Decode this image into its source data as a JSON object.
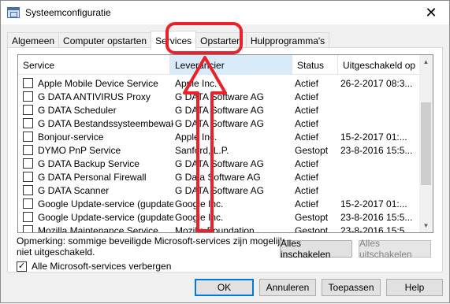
{
  "window": {
    "title": "Systeemconfiguratie"
  },
  "tabs": [
    {
      "label": "Algemeen"
    },
    {
      "label": "Computer opstarten"
    },
    {
      "label": "Services"
    },
    {
      "label": "Opstarten"
    },
    {
      "label": "Hulpprogramma's"
    }
  ],
  "columns": {
    "service": "Service",
    "manufacturer": "Leverancier",
    "status": "Status",
    "disabled_on": "Uitgeschakeld op"
  },
  "rows": [
    {
      "name": "Apple Mobile Device Service",
      "manufacturer": "Apple Inc.",
      "status": "Actief",
      "date": "26-2-2017 08:3..."
    },
    {
      "name": "G DATA ANTIVIRUS Proxy",
      "manufacturer": "G DATA Software AG",
      "status": "Actief",
      "date": ""
    },
    {
      "name": "G DATA Scheduler",
      "manufacturer": "G DATA Software AG",
      "status": "Actief",
      "date": ""
    },
    {
      "name": "G DATA Bestandssysteembewaker",
      "manufacturer": "G DATA Software AG",
      "status": "Actief",
      "date": ""
    },
    {
      "name": "Bonjour-service",
      "manufacturer": "Apple Inc.",
      "status": "Actief",
      "date": "15-2-2017 01:..."
    },
    {
      "name": "DYMO PnP Service",
      "manufacturer": "Sanford, L.P.",
      "status": "Gestopt",
      "date": "23-8-2016 15:5..."
    },
    {
      "name": "G DATA Backup Service",
      "manufacturer": "G DATA Software AG",
      "status": "Actief",
      "date": ""
    },
    {
      "name": "G DATA Personal Firewall",
      "manufacturer": "G Data Software AG",
      "status": "Actief",
      "date": ""
    },
    {
      "name": "G DATA Scanner",
      "manufacturer": "G DATA Software AG",
      "status": "Actief",
      "date": ""
    },
    {
      "name": "Google Update-service (gupdate)",
      "manufacturer": "Google Inc.",
      "status": "Actief",
      "date": "15-2-2017 01:..."
    },
    {
      "name": "Google Update-service (gupdatem)",
      "manufacturer": "Google Inc.",
      "status": "Gestopt",
      "date": "23-8-2016 15:5..."
    },
    {
      "name": "Mozilla Maintenance Service",
      "manufacturer": "Mozilla Foundation",
      "status": "Gestopt",
      "date": "23-8-2016 15:5..."
    }
  ],
  "note": "Opmerking: sommige beveiligde Microsoft-services zijn mogelijk niet uitgeschakeld.",
  "buttons": {
    "enable_all": "Alles inschakelen",
    "disable_all": "Alles uitschakelen",
    "ok": "OK",
    "cancel": "Annuleren",
    "apply": "Toepassen",
    "help": "Help"
  },
  "hide_ms": {
    "label": "Alle Microsoft-services verbergen",
    "checked": true
  },
  "icons": {
    "close": "close-icon",
    "app": "msconfig-icon",
    "check": "check-icon"
  },
  "colors": {
    "annotation": "#e8222a",
    "selected_tab": "#ffffff",
    "sorted_header": "#d9ebf9",
    "default_button_border": "#0078d7"
  }
}
